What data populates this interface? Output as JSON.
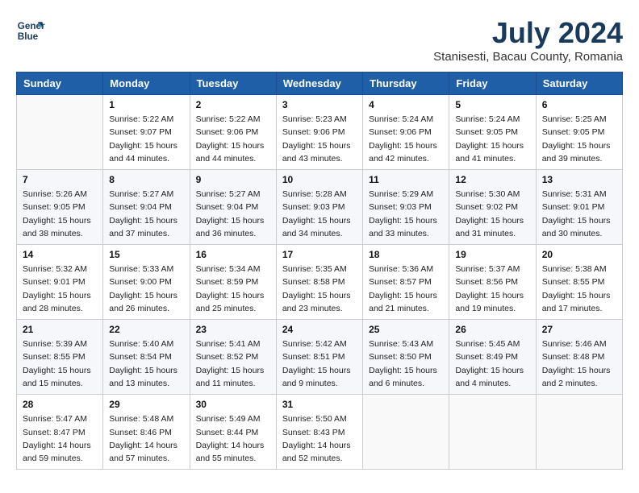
{
  "header": {
    "logo_line1": "General",
    "logo_line2": "Blue",
    "month_year": "July 2024",
    "location": "Stanisesti, Bacau County, Romania"
  },
  "days_of_week": [
    "Sunday",
    "Monday",
    "Tuesday",
    "Wednesday",
    "Thursday",
    "Friday",
    "Saturday"
  ],
  "weeks": [
    [
      {
        "day": "",
        "info": ""
      },
      {
        "day": "1",
        "info": "Sunrise: 5:22 AM\nSunset: 9:07 PM\nDaylight: 15 hours\nand 44 minutes."
      },
      {
        "day": "2",
        "info": "Sunrise: 5:22 AM\nSunset: 9:06 PM\nDaylight: 15 hours\nand 44 minutes."
      },
      {
        "day": "3",
        "info": "Sunrise: 5:23 AM\nSunset: 9:06 PM\nDaylight: 15 hours\nand 43 minutes."
      },
      {
        "day": "4",
        "info": "Sunrise: 5:24 AM\nSunset: 9:06 PM\nDaylight: 15 hours\nand 42 minutes."
      },
      {
        "day": "5",
        "info": "Sunrise: 5:24 AM\nSunset: 9:05 PM\nDaylight: 15 hours\nand 41 minutes."
      },
      {
        "day": "6",
        "info": "Sunrise: 5:25 AM\nSunset: 9:05 PM\nDaylight: 15 hours\nand 39 minutes."
      }
    ],
    [
      {
        "day": "7",
        "info": "Sunrise: 5:26 AM\nSunset: 9:05 PM\nDaylight: 15 hours\nand 38 minutes."
      },
      {
        "day": "8",
        "info": "Sunrise: 5:27 AM\nSunset: 9:04 PM\nDaylight: 15 hours\nand 37 minutes."
      },
      {
        "day": "9",
        "info": "Sunrise: 5:27 AM\nSunset: 9:04 PM\nDaylight: 15 hours\nand 36 minutes."
      },
      {
        "day": "10",
        "info": "Sunrise: 5:28 AM\nSunset: 9:03 PM\nDaylight: 15 hours\nand 34 minutes."
      },
      {
        "day": "11",
        "info": "Sunrise: 5:29 AM\nSunset: 9:03 PM\nDaylight: 15 hours\nand 33 minutes."
      },
      {
        "day": "12",
        "info": "Sunrise: 5:30 AM\nSunset: 9:02 PM\nDaylight: 15 hours\nand 31 minutes."
      },
      {
        "day": "13",
        "info": "Sunrise: 5:31 AM\nSunset: 9:01 PM\nDaylight: 15 hours\nand 30 minutes."
      }
    ],
    [
      {
        "day": "14",
        "info": "Sunrise: 5:32 AM\nSunset: 9:01 PM\nDaylight: 15 hours\nand 28 minutes."
      },
      {
        "day": "15",
        "info": "Sunrise: 5:33 AM\nSunset: 9:00 PM\nDaylight: 15 hours\nand 26 minutes."
      },
      {
        "day": "16",
        "info": "Sunrise: 5:34 AM\nSunset: 8:59 PM\nDaylight: 15 hours\nand 25 minutes."
      },
      {
        "day": "17",
        "info": "Sunrise: 5:35 AM\nSunset: 8:58 PM\nDaylight: 15 hours\nand 23 minutes."
      },
      {
        "day": "18",
        "info": "Sunrise: 5:36 AM\nSunset: 8:57 PM\nDaylight: 15 hours\nand 21 minutes."
      },
      {
        "day": "19",
        "info": "Sunrise: 5:37 AM\nSunset: 8:56 PM\nDaylight: 15 hours\nand 19 minutes."
      },
      {
        "day": "20",
        "info": "Sunrise: 5:38 AM\nSunset: 8:55 PM\nDaylight: 15 hours\nand 17 minutes."
      }
    ],
    [
      {
        "day": "21",
        "info": "Sunrise: 5:39 AM\nSunset: 8:55 PM\nDaylight: 15 hours\nand 15 minutes."
      },
      {
        "day": "22",
        "info": "Sunrise: 5:40 AM\nSunset: 8:54 PM\nDaylight: 15 hours\nand 13 minutes."
      },
      {
        "day": "23",
        "info": "Sunrise: 5:41 AM\nSunset: 8:52 PM\nDaylight: 15 hours\nand 11 minutes."
      },
      {
        "day": "24",
        "info": "Sunrise: 5:42 AM\nSunset: 8:51 PM\nDaylight: 15 hours\nand 9 minutes."
      },
      {
        "day": "25",
        "info": "Sunrise: 5:43 AM\nSunset: 8:50 PM\nDaylight: 15 hours\nand 6 minutes."
      },
      {
        "day": "26",
        "info": "Sunrise: 5:45 AM\nSunset: 8:49 PM\nDaylight: 15 hours\nand 4 minutes."
      },
      {
        "day": "27",
        "info": "Sunrise: 5:46 AM\nSunset: 8:48 PM\nDaylight: 15 hours\nand 2 minutes."
      }
    ],
    [
      {
        "day": "28",
        "info": "Sunrise: 5:47 AM\nSunset: 8:47 PM\nDaylight: 14 hours\nand 59 minutes."
      },
      {
        "day": "29",
        "info": "Sunrise: 5:48 AM\nSunset: 8:46 PM\nDaylight: 14 hours\nand 57 minutes."
      },
      {
        "day": "30",
        "info": "Sunrise: 5:49 AM\nSunset: 8:44 PM\nDaylight: 14 hours\nand 55 minutes."
      },
      {
        "day": "31",
        "info": "Sunrise: 5:50 AM\nSunset: 8:43 PM\nDaylight: 14 hours\nand 52 minutes."
      },
      {
        "day": "",
        "info": ""
      },
      {
        "day": "",
        "info": ""
      },
      {
        "day": "",
        "info": ""
      }
    ]
  ]
}
